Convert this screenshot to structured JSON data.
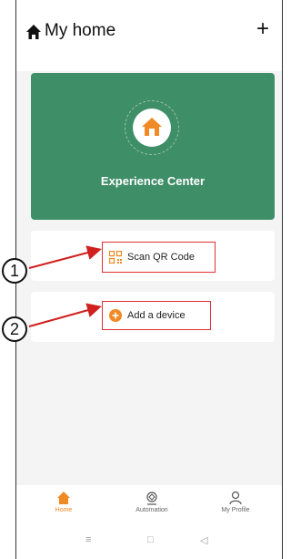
{
  "header": {
    "title": "My home",
    "add_label": "+"
  },
  "experience": {
    "label": "Experience Center"
  },
  "actions": {
    "scan_label": "Scan QR Code",
    "add_device_label": "Add a device"
  },
  "annotations": {
    "marker_1": "1",
    "marker_2": "2"
  },
  "tabs": [
    {
      "label": "Home",
      "icon": "home-icon",
      "active": true
    },
    {
      "label": "Automation",
      "icon": "automation-icon",
      "active": false
    },
    {
      "label": "My Profile",
      "icon": "profile-icon",
      "active": false
    }
  ],
  "system_nav": {
    "menu": "≡",
    "home": "□",
    "back": "◁"
  },
  "colors": {
    "accent": "#f08a24",
    "card_green": "#3e8e67",
    "annotation_red": "#e03030"
  }
}
